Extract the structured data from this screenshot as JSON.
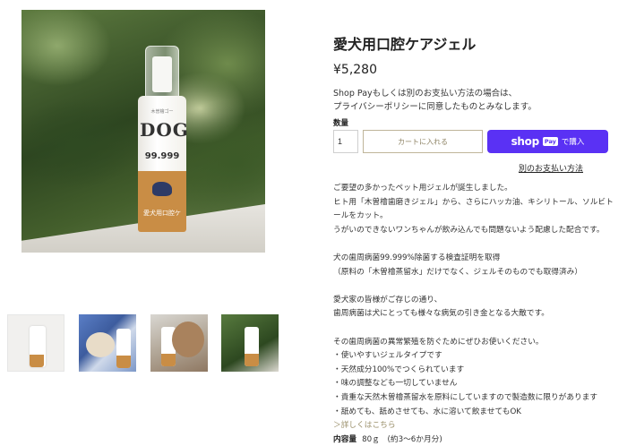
{
  "product": {
    "title": "愛犬用口腔ケアジェル",
    "price": "¥5,280",
    "shop_pay_note": [
      "Shop Payもしくは別のお支払い方法の場合は、",
      "プライバシーポリシーに同意したものとみなします。"
    ]
  },
  "main_image": {
    "label_top": "木曽檜ゴー",
    "label_brand": "DOG",
    "label_pct": "99.999",
    "label_band": "愛犬用口腔ケ"
  },
  "purchase": {
    "quantity_label": "数量",
    "quantity_value": "1",
    "add_to_cart_label": "カートに入れる",
    "shop_pay_word": "shop",
    "shop_pay_pill": "Pay",
    "shop_pay_suffix": "で購入",
    "other_payment_label": "別のお支払い方法"
  },
  "description": {
    "lines": [
      "ご要望の多かったペット用ジェルが誕生しました。",
      "ヒト用「木曽檜歯磨きジェル」から、さらにハッカ油、キシリトール、ソルビト",
      "ールをカット。",
      "うがいのできないワンちゃんが飲み込んでも問題ないよう配慮した配合です。",
      "",
      "犬の歯周病菌99.999%除菌する検査証明を取得",
      "（原料の「木曽檜蒸留水」だけでなく、ジェルそのものでも取得済み）",
      "",
      "愛犬家の皆様がご存じの通り、",
      "歯周病菌は犬にとっても様々な病気の引き金となる大敵です。",
      "",
      "その歯周病菌の異常繁殖を防ぐためにぜひお使いください。",
      "・使いやすいジェルタイプです",
      "・天然成分100%でつくられています",
      "・味の調整なども一切していません",
      "・貴重な天然木曽檜蒸留水を原料にしていますので製造数に限りがあります",
      "・舐めても、舐めさせても、水に溶いて飲ませてもOK"
    ],
    "more_link": "＞詳しくはこちら",
    "capacity_label": "内容量",
    "capacity_value": "80ｇ　(約3〜6か月分)"
  },
  "colors": {
    "shop_pay": "#5a31f4",
    "cart_border": "#bfb59a",
    "link": "#9a8f6a"
  },
  "icons": [
    "shop-pay-logo"
  ]
}
